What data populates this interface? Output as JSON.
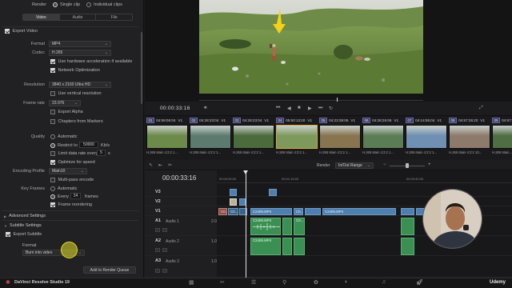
{
  "render": {
    "label": "Render",
    "single_clip": "Single clip",
    "individual_clips": "Individual clips"
  },
  "tabs": [
    "Video",
    "Audio",
    "File"
  ],
  "export_video": "Export Video",
  "format": {
    "label": "Format",
    "value": "MP4"
  },
  "codec": {
    "label": "Codec",
    "value": "H.265"
  },
  "use_hw_accel": "Use hardware acceleration if available",
  "network_opt": "Network Optimization",
  "resolution": {
    "label": "Resolution",
    "value": "3840 x 2160 Ultra HD"
  },
  "use_vertical": "Use vertical resolution",
  "frame_rate": {
    "label": "Frame rate",
    "value": "23.976"
  },
  "export_alpha": "Export Alpha",
  "chapters": "Chapters from Markers",
  "quality": {
    "label": "Quality",
    "automatic": "Automatic",
    "restrict_to": "Restrict to",
    "restrict_value": "50000",
    "unit": "Kb/s"
  },
  "limit_rate": "Limit data rate every",
  "limit_value": "5",
  "limit_unit": "s",
  "optimize_speed": "Optimize for speed",
  "encoding_profile": {
    "label": "Encoding Profile",
    "value": "Main10"
  },
  "multipass": "Multi-pass encode",
  "key_frames": {
    "label": "Key Frames",
    "automatic": "Automatic",
    "every": "Every",
    "value": "24",
    "unit": "frames"
  },
  "frame_reorder": "Frame reordering",
  "advanced_settings": "Advanced Settings",
  "subtitle_settings": "Subtitle Settings",
  "export_subtitle": "Export Subtitle",
  "subtitle_format": {
    "label": "Format",
    "value": "Burn into video"
  },
  "add_render_queue": "Add to Render Queue",
  "viewer_timecode": "00:00:33:16",
  "timeline_timecode": "00:00:33:16",
  "render_mode": {
    "label": "Render",
    "value": "In/Out Range"
  },
  "clips": [
    {
      "num": "01",
      "tc": "04:59:06:04",
      "v": "V1",
      "codec": "H.265 Main 4:2:2 1...",
      "thumb": "#6c8a4a"
    },
    {
      "num": "02",
      "tc": "04:28:23:04",
      "v": "V1",
      "codec": "H.265 Main 4:2:2 1...",
      "thumb": "#5c7a6e"
    },
    {
      "num": "03",
      "tc": "04:28:23:04",
      "v": "V1",
      "codec": "H.265 Main 4:2:2 1...",
      "thumb": "#4b6b3c"
    },
    {
      "num": "04",
      "tc": "05:50:13:20",
      "v": "V1",
      "codec": "H.265 Main 4:2:2 1...",
      "thumb": "#7d9a5c"
    },
    {
      "num": "05",
      "tc": "04:23:39:06",
      "v": "V1",
      "codec": "H.265 Main 4:2:2 1...",
      "thumb": "#88744f"
    },
    {
      "num": "06",
      "tc": "04:28:26:06",
      "v": "V1",
      "codec": "H.265 Main 4:2:2 1...",
      "thumb": "#5a7d55"
    },
    {
      "num": "07",
      "tc": "04:14:55:04",
      "v": "V1",
      "codec": "H.265 Main 4:2:2 1...",
      "thumb": "#6f8fb3"
    },
    {
      "num": "08",
      "tc": "04:57:26:20",
      "v": "V1",
      "codec": "H.265 Main 4:2:2 10...",
      "thumb": "#8d7a6a"
    },
    {
      "num": "09",
      "tc": "04:57:56:12",
      "v": "V1",
      "codec": "H.265 Main...",
      "thumb": "#4f6e44"
    }
  ],
  "ruler": [
    "00:00:00:00",
    "00:01:14:00",
    "00:03:42:00"
  ],
  "tracks": [
    {
      "name": "V3",
      "type": "video"
    },
    {
      "name": "V2",
      "type": "video"
    },
    {
      "name": "V1",
      "type": "video"
    },
    {
      "name": "A1",
      "label": "Audio 1",
      "level": "2.0",
      "type": "audio"
    },
    {
      "name": "A2",
      "label": "Audio 2",
      "level": "1.0",
      "type": "audio"
    },
    {
      "name": "A3",
      "label": "Audio 3",
      "level": "1.0",
      "type": "audio"
    }
  ],
  "timeline_clips": {
    "c2406_a": "C2406.MP4",
    "c2406_b": "C2406.MP4",
    "c2406_c": "C2406.MP4",
    "c2406_d": "C2406.MP4",
    "c2406_e": "C2406.MP4",
    "c0_a": "C0...",
    "c0_b": "C0...",
    "c0_c": "C0..",
    "c0_d": "C0..."
  },
  "app_name": "DaVinci Resolve Studio 19",
  "watermark": "Udemy"
}
